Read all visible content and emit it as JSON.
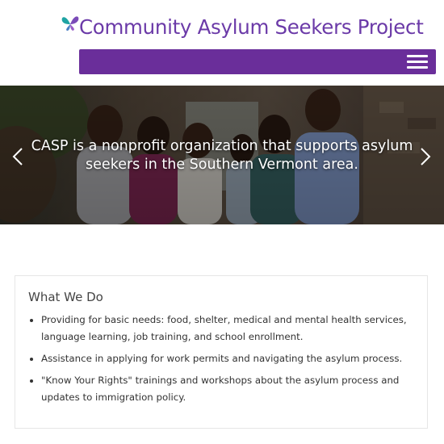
{
  "header": {
    "site_title": "Community Asylum Seekers Project",
    "logo_icon": "butterfly-icon",
    "menu_icon": "hamburger-menu-icon",
    "brand_color": "#6a2e9a"
  },
  "hero": {
    "caption": "CASP is a nonprofit organization that supports asylum seekers in the Southern Vermont area.",
    "prev_icon": "chevron-left-icon",
    "next_icon": "chevron-right-icon"
  },
  "what_we_do": {
    "title": "What We Do",
    "items": [
      "Providing for basic needs: food, shelter, medical and mental health services, language learning, job training, and school enrollment.",
      "Assistance in applying for work permits and navigating the asylum process.",
      "\"Know Your Rights\" trainings and workshops about the asylum process and updates to immigration policy."
    ]
  }
}
